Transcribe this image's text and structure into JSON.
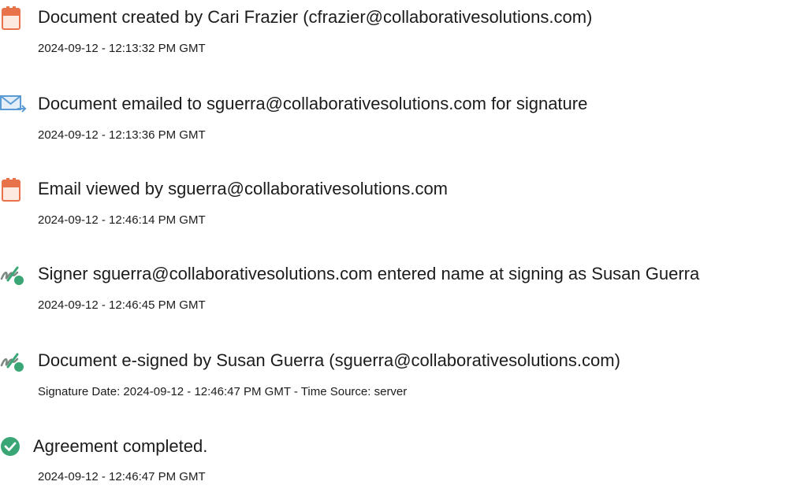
{
  "events": [
    {
      "icon": "document-icon",
      "title": "Document created by Cari Frazier (cfrazier@collaborativesolutions.com)",
      "detail": "2024-09-12 - 12:13:32 PM GMT"
    },
    {
      "icon": "email-icon",
      "title": "Document emailed to sguerra@collaborativesolutions.com for signature",
      "detail": "2024-09-12 - 12:13:36 PM GMT"
    },
    {
      "icon": "document-icon",
      "title": "Email viewed by sguerra@collaborativesolutions.com",
      "detail": "2024-09-12 - 12:46:14 PM GMT"
    },
    {
      "icon": "signature-icon",
      "title": "Signer sguerra@collaborativesolutions.com entered name at signing as Susan Guerra",
      "detail": "2024-09-12 - 12:46:45 PM GMT"
    },
    {
      "icon": "signature-icon",
      "title": "Document e-signed by Susan Guerra (sguerra@collaborativesolutions.com)",
      "detail": "Signature Date: 2024-09-12 - 12:46:47 PM GMT - Time Source: server"
    },
    {
      "icon": "check-circle-icon",
      "title": "Agreement completed.",
      "detail": "2024-09-12 - 12:46:47 PM GMT"
    }
  ],
  "colors": {
    "document_icon": "#e8734a",
    "email_icon": "#5b9bd5",
    "signature_icon": "#3aa676",
    "check_icon": "#3aa676"
  }
}
